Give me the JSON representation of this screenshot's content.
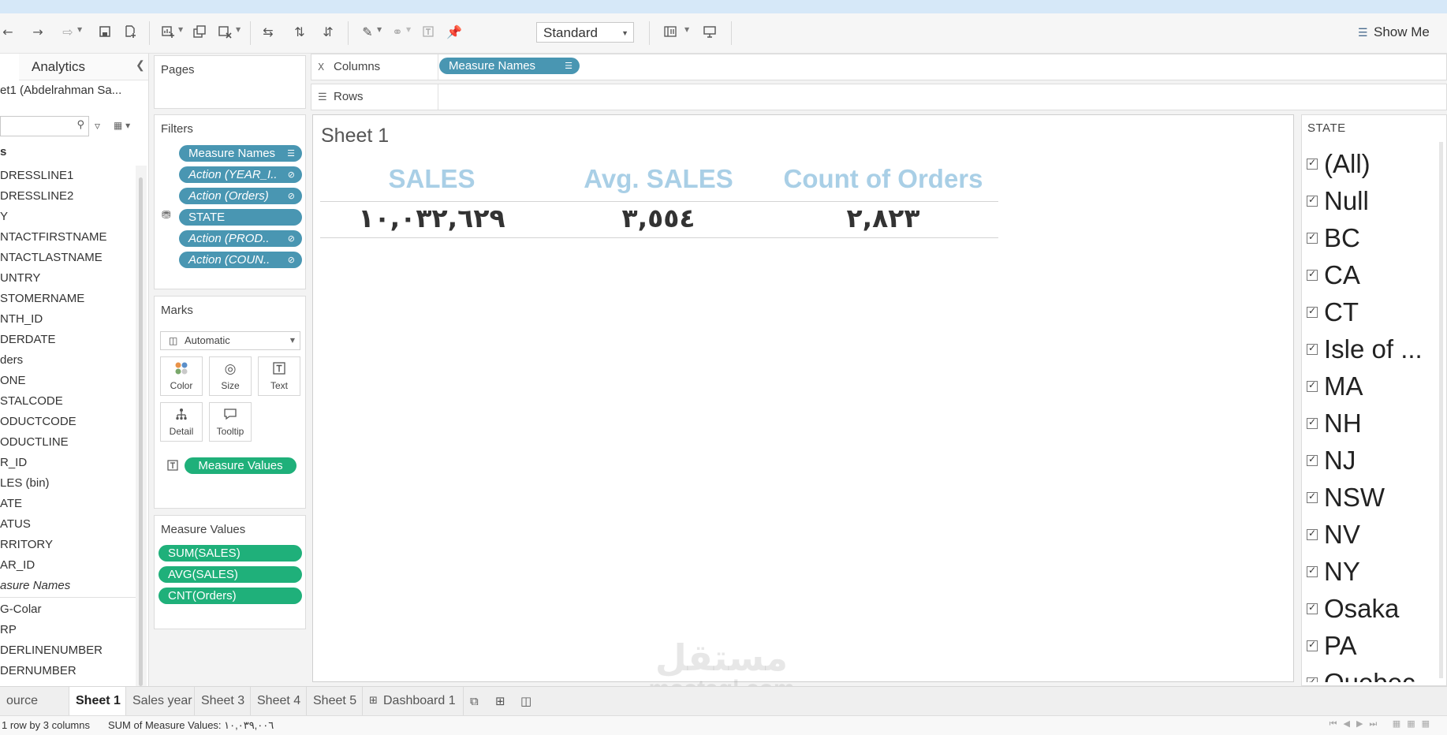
{
  "toolbar": {
    "fit_value": "Standard",
    "show_me_label": "Show Me"
  },
  "data_pane": {
    "analytics_tab": "Analytics",
    "datasource": "et1 (Abdelrahman Sa...",
    "fields": [
      "s",
      "DRESSLINE1",
      "DRESSLINE2",
      "Y",
      "NTACTFIRSTNAME",
      "NTACTLASTNAME",
      "UNTRY",
      "STOMERNAME",
      "NTH_ID",
      "DERDATE",
      "ders",
      "ONE",
      "STALCODE",
      "ODUCTCODE",
      "ODUCTLINE",
      "R_ID",
      "LES (bin)",
      "ATE",
      "ATUS",
      "RRITORY",
      "AR_ID",
      "asure Names"
    ],
    "measures": [
      "G-Colar",
      "RP",
      "DERLINENUMBER",
      "DERNUMBER"
    ]
  },
  "pages": {
    "title": "Pages"
  },
  "filters": {
    "title": "Filters",
    "pills": [
      "Measure Names",
      "Action (YEAR_I..",
      "Action (Orders)",
      "STATE",
      "Action (PROD..",
      "Action (COUN.."
    ]
  },
  "marks": {
    "title": "Marks",
    "type": "Automatic",
    "buttons": [
      "Color",
      "Size",
      "Text",
      "Detail",
      "Tooltip"
    ],
    "text_pill": "Measure Values"
  },
  "measure_values": {
    "title": "Measure Values",
    "pills": [
      "SUM(SALES)",
      "AVG(SALES)",
      "CNT(Orders)"
    ]
  },
  "shelves": {
    "columns_label": "Columns",
    "columns_pill": "Measure Names",
    "rows_label": "Rows"
  },
  "view": {
    "title": "Sheet 1",
    "headers": [
      "SALES",
      "Avg. SALES",
      "Count of Orders"
    ],
    "values": [
      "١٠,٠٣٢,٦٢٩",
      "٣,٥٥٤",
      "٢,٨٢٣"
    ]
  },
  "state_filter": {
    "title": "STATE",
    "items": [
      "(All)",
      "Null",
      "BC",
      "CA",
      "CT",
      "Isle of ...",
      "MA",
      "NH",
      "NJ",
      "NSW",
      "NV",
      "NY",
      "Osaka",
      "PA",
      "Quebec"
    ]
  },
  "tabs": {
    "source": "ource",
    "sheets": [
      "Sheet 1",
      "Sales year",
      "Sheet 3",
      "Sheet 4",
      "Sheet 5",
      "Dashboard 1"
    ],
    "active": "Sheet 1"
  },
  "status": {
    "rows_cols": "1 row by 3 columns",
    "sum": "SUM of Measure Values: ١٠,٠٣٩,٠٠٦"
  },
  "watermark": {
    "logo": "مستقل",
    "site": "mostaql.com"
  }
}
